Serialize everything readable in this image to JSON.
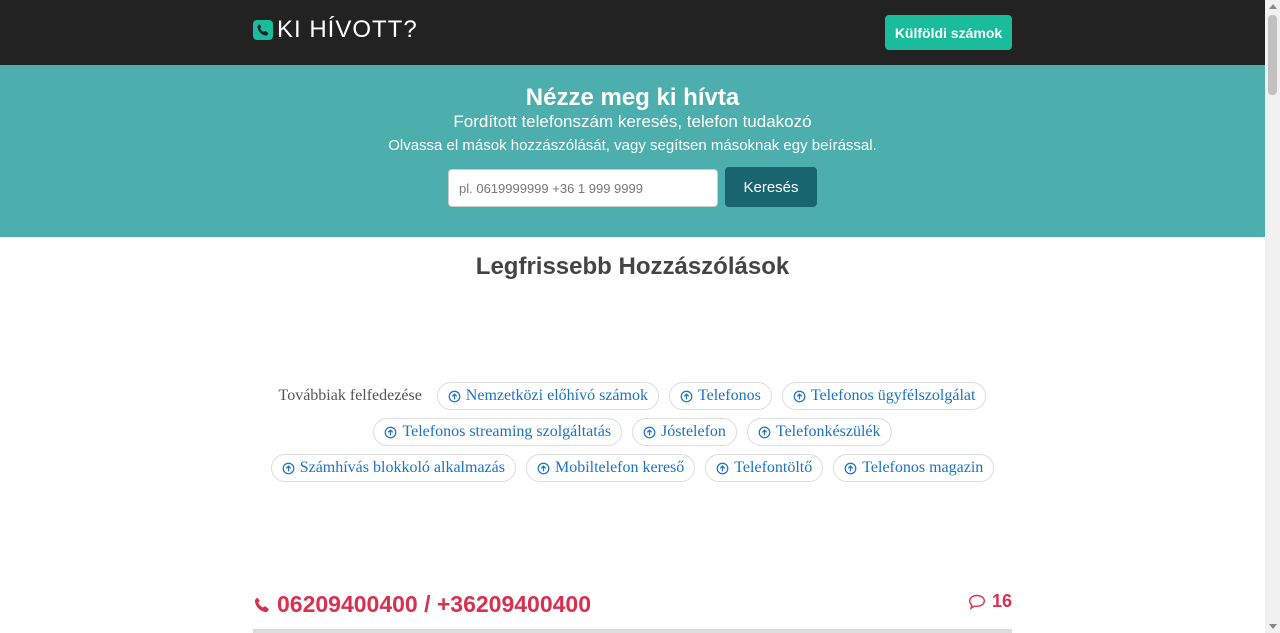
{
  "navbar": {
    "brand": "KI HÍVOTT?",
    "brand_icon": "phone-icon",
    "foreign_button": "Külföldi számok"
  },
  "hero": {
    "title": "Nézze meg ki hívta",
    "subtitle": "Fordított telefonszám keresés, telefon tudakozó",
    "description": "Olvassa el mások hozzászólását, vagy segítsen másoknak egy beírással.",
    "search_placeholder": "pl. 0619999999 +36 1 999 9999",
    "search_value": "",
    "search_button": "Keresés"
  },
  "section": {
    "title": "Legfrissebb Hozzászólások"
  },
  "explore": {
    "label": "Továbbiak felfedezése",
    "chips": [
      "Nemzetközi előhívó számok",
      "Telefonos",
      "Telefonos ügyfélszolgálat",
      "Telefonos streaming szolgáltatás",
      "Jóstelefon",
      "Telefonkészülék",
      "Számhívás blokkoló alkalmazás",
      "Mobiltelefon kereső",
      "Telefontöltő",
      "Telefonos magazin"
    ]
  },
  "entry": {
    "phone": "06209400400 / +36209400400",
    "comment_count": "16",
    "phone_icon": "phone-icon",
    "comment_icon": "comment-icon"
  },
  "colors": {
    "navbar_bg": "#222222",
    "accent": "#1abc9c",
    "hero_bg": "#4caead",
    "search_button_bg": "#19656f",
    "entry_red": "#d9304f",
    "chip_text": "#1a73c8"
  }
}
